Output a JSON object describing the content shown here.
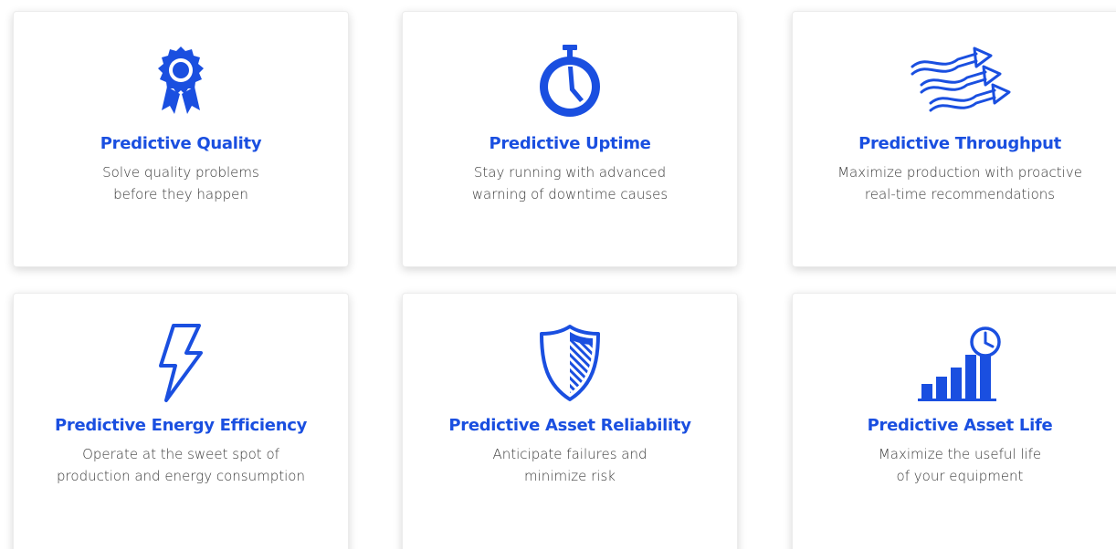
{
  "colors": {
    "accent": "#1a4fe0",
    "text": "#3a3a3a"
  },
  "cards": [
    {
      "icon": "award-ribbon-icon",
      "title": "Predictive Quality",
      "lines": [
        "Solve quality problems",
        "before they happen"
      ]
    },
    {
      "icon": "stopwatch-icon",
      "title": "Predictive Uptime",
      "lines": [
        "Stay running with advanced",
        "warning of downtime causes"
      ]
    },
    {
      "icon": "flow-arrows-icon",
      "title": "Predictive Throughput",
      "lines": [
        "Maximize production with proactive",
        "real-time recommendations"
      ]
    },
    {
      "icon": "lightning-bolt-icon",
      "title": "Predictive Energy Efficiency",
      "lines": [
        "Operate at the sweet spot of",
        "production and energy consumption"
      ]
    },
    {
      "icon": "shield-icon",
      "title": "Predictive Asset Reliability",
      "lines": [
        "Anticipate failures and",
        "minimize risk"
      ]
    },
    {
      "icon": "bar-chart-clock-icon",
      "title": "Predictive Asset Life",
      "lines": [
        "Maximize the useful life",
        "of your equipment"
      ]
    }
  ]
}
